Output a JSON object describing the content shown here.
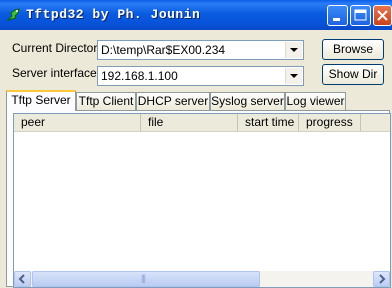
{
  "window": {
    "title": "Tftpd32 by Ph. Jounin",
    "controls": [
      "minimize-icon",
      "maximize-icon",
      "close-icon"
    ]
  },
  "form": {
    "current_directory_label": "Current Directory",
    "current_directory_value": "D:\\temp\\Rar$EX00.234",
    "server_interface_label": "Server interface",
    "server_interface_value": "192.168.1.100",
    "browse_button": "Browse",
    "show_dir_button": "Show Dir"
  },
  "tabs": [
    {
      "label": "Tftp Server",
      "active": true
    },
    {
      "label": "Tftp Client",
      "active": false
    },
    {
      "label": "DHCP server",
      "active": false
    },
    {
      "label": "Syslog server",
      "active": false
    },
    {
      "label": "Log viewer",
      "active": false
    }
  ],
  "table": {
    "columns": [
      "peer",
      "file",
      "start time",
      "progress"
    ],
    "rows": []
  },
  "scrollbar": {
    "thumb_glyph": "|||"
  }
}
